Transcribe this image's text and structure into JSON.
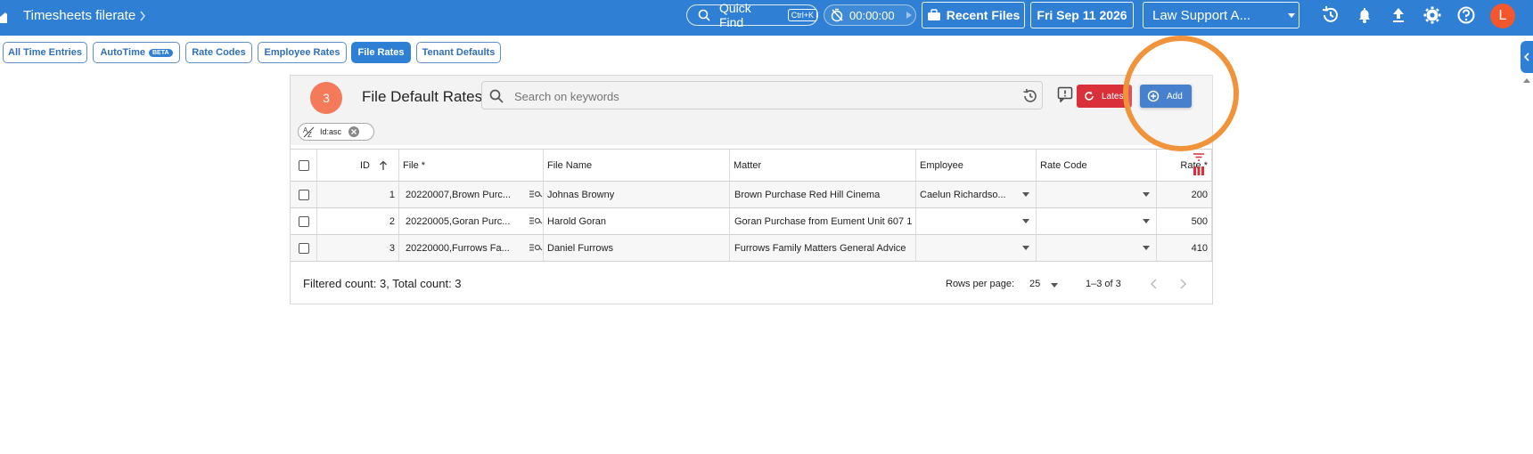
{
  "topbar": {
    "title": "Timesheets filerate",
    "quick_find": "Quick Find",
    "quick_find_shortcut": "Ctrl+K",
    "timer": "00:00:00",
    "recent_files": "Recent Files",
    "date": "Fri Sep 11 2026",
    "workspace": "Law Support A...",
    "avatar_letter": "L",
    "color_accent": "#2f80d4",
    "color_avatar": "#f2572d"
  },
  "tabs": [
    {
      "label": "All Time Entries"
    },
    {
      "label": "AutoTime",
      "badge": "BETA"
    },
    {
      "label": "Rate Codes"
    },
    {
      "label": "Employee Rates"
    },
    {
      "label": "File Rates",
      "active": true
    },
    {
      "label": "Tenant Defaults"
    }
  ],
  "panel": {
    "step_badge": "3",
    "title": "File Default Rates",
    "search_placeholder": "Search on keywords",
    "latest_label": "Lates",
    "add_label": "Add",
    "sort_chip": "Id:asc",
    "columns": {
      "id": "ID",
      "file": "File *",
      "file_name": "File Name",
      "matter": "Matter",
      "employee": "Employee",
      "rate_code": "Rate Code",
      "rate": "Rate *"
    },
    "rows": [
      {
        "id": "1",
        "file": "20220007,Brown Purc...",
        "file_name": "Johnas Browny",
        "matter": "Brown Purchase Red Hill Cinema",
        "employee": "Caelun Richardso...",
        "rate_code": "",
        "rate": "200"
      },
      {
        "id": "2",
        "file": "20220005,Goran Purc...",
        "file_name": "Harold Goran",
        "matter": "Goran Purchase from Eument Unit 607 1",
        "employee": "",
        "rate_code": "",
        "rate": "500"
      },
      {
        "id": "3",
        "file": "20220000,Furrows Fa...",
        "file_name": "Daniel Furrows",
        "matter": "Furrows Family Matters General Advice",
        "employee": "",
        "rate_code": "",
        "rate": "410"
      }
    ],
    "footer": {
      "counts": "Filtered count: 3, Total count: 3",
      "rows_per_page_label": "Rows per page:",
      "rows_per_page_value": "25",
      "range": "1–3 of 3"
    }
  },
  "highlight_color": "#f0933a"
}
